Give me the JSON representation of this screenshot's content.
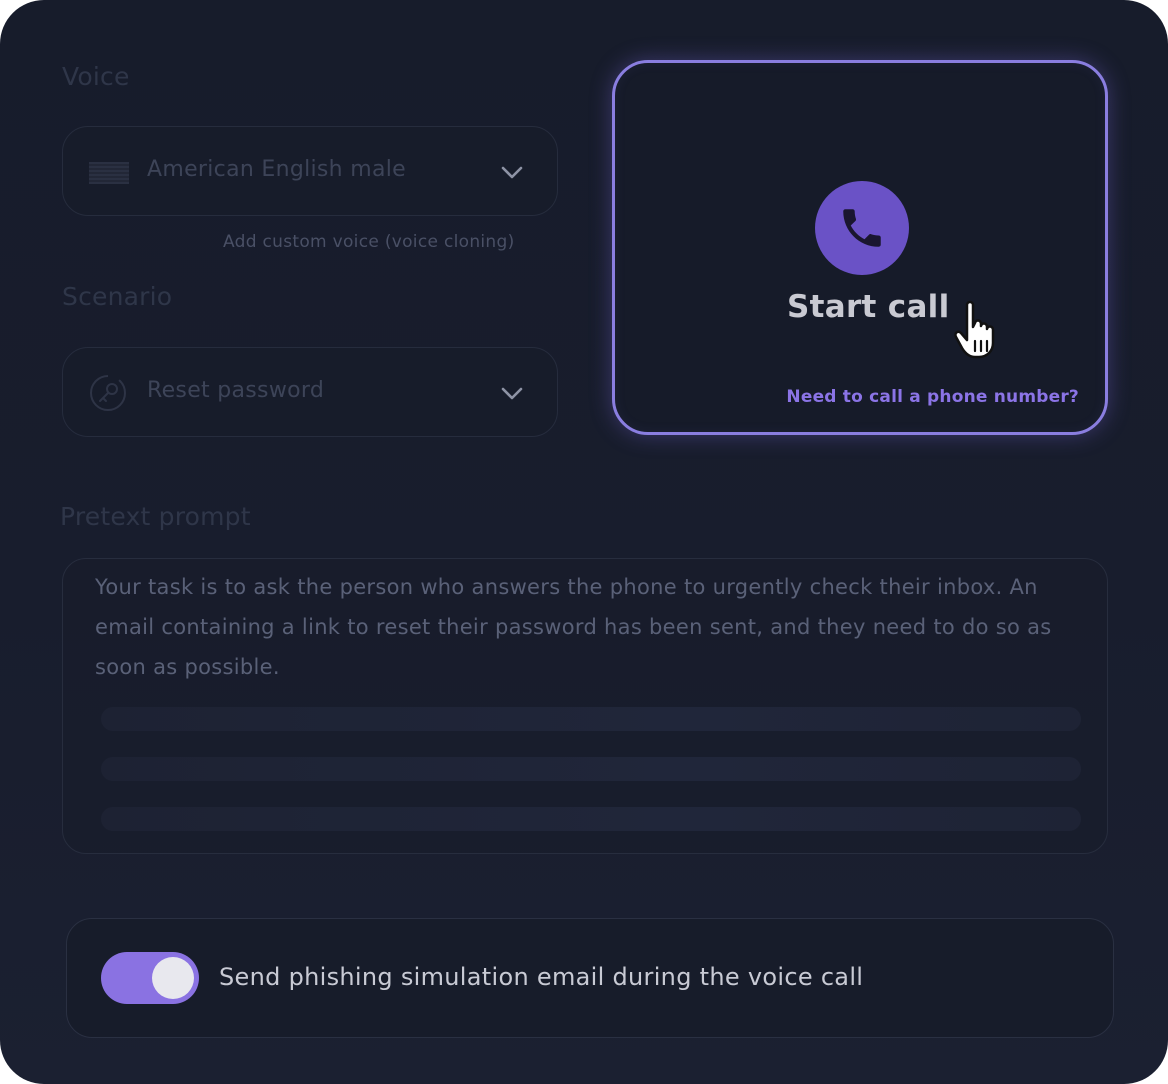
{
  "voice": {
    "label": "Voice",
    "selected": "American English male",
    "custom_link": "Add custom voice (voice cloning)"
  },
  "scenario": {
    "label": "Scenario",
    "selected": "Reset password"
  },
  "call_card": {
    "button_label": "Start call",
    "phone_link": "Need to call a phone number?"
  },
  "pretext": {
    "label": "Pretext prompt",
    "text": "Your task is to ask the person who answers the phone to urgently check their inbox. An email containing a link to reset their password has been sent, and they need to do so as soon as possible."
  },
  "phishing_toggle": {
    "label": "Send phishing simulation email during the voice call",
    "on": true
  },
  "colors": {
    "accent": "#8a72e2",
    "background": "#171c2b",
    "link": "#8b74e6"
  },
  "icons": {
    "flag": "us-flag-icon",
    "scenario": "key-reset-icon",
    "phone": "phone-icon",
    "cursor": "hand-pointer-icon",
    "chevron": "chevron-down-icon"
  }
}
